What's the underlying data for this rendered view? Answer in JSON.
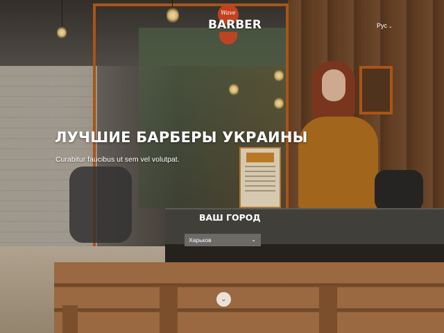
{
  "header": {
    "logo_script": "Wave",
    "logo_word": "BARBER",
    "lang_label": "Рус",
    "lang_chevron": "⌄"
  },
  "hero": {
    "title": "ЛУЧШИЕ БАРБЕРЫ УКРАИНЫ",
    "subtitle": "Curabitur faucibus ut sem vel volutpat."
  },
  "city": {
    "label": "ВАШ ГОРОД",
    "selected": "Харьков",
    "chevron": "⌄"
  },
  "scroll": {
    "icon": "chevron-down-icon",
    "glyph": "⌄"
  },
  "colors": {
    "accent": "#c2601c",
    "logo_red": "#c9431f"
  }
}
